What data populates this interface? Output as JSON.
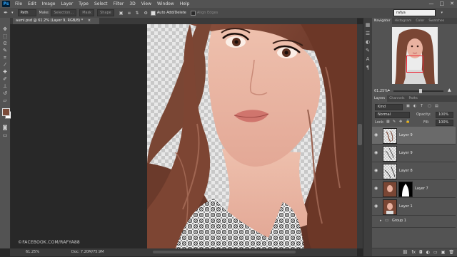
{
  "app": {
    "logo": "Ps"
  },
  "menu": [
    "File",
    "Edit",
    "Image",
    "Layer",
    "Type",
    "Select",
    "Filter",
    "3D",
    "View",
    "Window",
    "Help"
  ],
  "window_controls": {
    "minimize": "—",
    "maximize": "□",
    "close": "✕"
  },
  "options_bar": {
    "mode": "Path",
    "make": "Make:",
    "selection": "Selection...",
    "mask": "Mask",
    "shape": "Shape",
    "auto_add_delete": "Auto Add/Delete",
    "align_edges": "Align Edges",
    "search_value": "rafya"
  },
  "document": {
    "tab_title": "aumi.psd @ 61.2% (Layer 9, RGB/8) *",
    "close": "×"
  },
  "status": {
    "zoom": "61.25%",
    "doc_info": "Doc: 7.20M/75.9M"
  },
  "watermark": "©FACEBOOK.COM/RAFYA88",
  "navigator": {
    "tabs": [
      "Navigator",
      "Histogram",
      "Color",
      "Swatches"
    ],
    "zoom": "61.25%"
  },
  "layers_panel": {
    "tabs": [
      "Layers",
      "Channels",
      "Paths"
    ],
    "filter": "Kind",
    "blend_mode": "Normal",
    "opacity_label": "Opacity:",
    "opacity": "100%",
    "lock_label": "Lock:",
    "fill_label": "Fill:",
    "fill": "100%",
    "layers": [
      {
        "name": "Layer 9",
        "selected": true,
        "mask": false
      },
      {
        "name": "Layer 9",
        "selected": false,
        "mask": false
      },
      {
        "name": "Layer 8",
        "selected": false,
        "mask": false
      },
      {
        "name": "Layer 7",
        "selected": false,
        "mask": true
      },
      {
        "name": "Layer 1",
        "selected": false,
        "mask": false
      },
      {
        "name": "Group 1",
        "selected": false,
        "mask": false
      }
    ]
  },
  "colors": {
    "foreground": "#7b4c3a",
    "background": "#ffffff",
    "hair": "#7a4634",
    "skin": "#e9b2a0"
  }
}
